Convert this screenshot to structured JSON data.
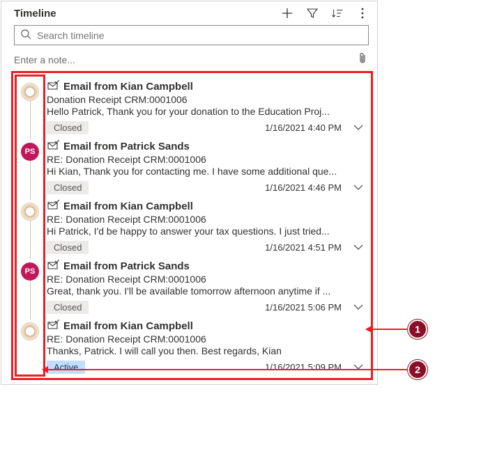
{
  "header": {
    "title": "Timeline"
  },
  "search": {
    "placeholder": "Search timeline"
  },
  "note": {
    "placeholder": "Enter a note..."
  },
  "items": [
    {
      "avatar_type": "kc",
      "avatar_initials": "",
      "title": "Email from Kian Campbell",
      "subject": "Donation Receipt CRM:0001006",
      "preview": "Hello Patrick,   Thank you for your donation to the Education Proj...",
      "status": "Closed",
      "status_kind": "closed",
      "timestamp": "1/16/2021 4:40 PM"
    },
    {
      "avatar_type": "ps",
      "avatar_initials": "PS",
      "title": "Email from Patrick Sands",
      "subject": "RE: Donation Receipt CRM:0001006",
      "preview": "Hi Kian, Thank you for contacting me. I have some additional que...",
      "status": "Closed",
      "status_kind": "closed",
      "timestamp": "1/16/2021 4:46 PM"
    },
    {
      "avatar_type": "kc",
      "avatar_initials": "",
      "title": "Email from Kian Campbell",
      "subject": "RE: Donation Receipt CRM:0001006",
      "preview": "Hi Patrick,   I'd be happy to answer your tax questions. I just tried...",
      "status": "Closed",
      "status_kind": "closed",
      "timestamp": "1/16/2021 4:51 PM"
    },
    {
      "avatar_type": "ps",
      "avatar_initials": "PS",
      "title": "Email from Patrick Sands",
      "subject": "RE: Donation Receipt CRM:0001006",
      "preview": "Great, thank you. I'll be available tomorrow afternoon anytime if ...",
      "status": "Closed",
      "status_kind": "closed",
      "timestamp": "1/16/2021 5:06 PM"
    },
    {
      "avatar_type": "kc",
      "avatar_initials": "",
      "title": "Email from Kian Campbell",
      "subject": "RE: Donation Receipt CRM:0001006",
      "preview": "Thanks, Patrick. I will call you then.   Best regards, Kian",
      "status": "Active",
      "status_kind": "active",
      "timestamp": "1/16/2021 5:09 PM"
    }
  ],
  "annotations": {
    "marker1": "1",
    "marker2": "2"
  }
}
